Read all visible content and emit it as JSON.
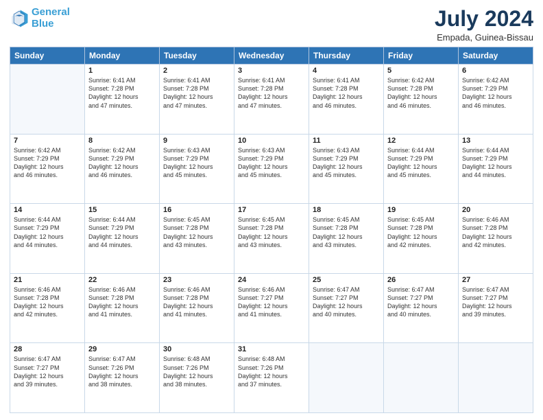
{
  "header": {
    "logo_line1": "General",
    "logo_line2": "Blue",
    "main_title": "July 2024",
    "subtitle": "Empada, Guinea-Bissau"
  },
  "days_of_week": [
    "Sunday",
    "Monday",
    "Tuesday",
    "Wednesday",
    "Thursday",
    "Friday",
    "Saturday"
  ],
  "weeks": [
    [
      {
        "day": "",
        "info": ""
      },
      {
        "day": "1",
        "info": "Sunrise: 6:41 AM\nSunset: 7:28 PM\nDaylight: 12 hours\nand 47 minutes."
      },
      {
        "day": "2",
        "info": "Sunrise: 6:41 AM\nSunset: 7:28 PM\nDaylight: 12 hours\nand 47 minutes."
      },
      {
        "day": "3",
        "info": "Sunrise: 6:41 AM\nSunset: 7:28 PM\nDaylight: 12 hours\nand 47 minutes."
      },
      {
        "day": "4",
        "info": "Sunrise: 6:41 AM\nSunset: 7:28 PM\nDaylight: 12 hours\nand 46 minutes."
      },
      {
        "day": "5",
        "info": "Sunrise: 6:42 AM\nSunset: 7:28 PM\nDaylight: 12 hours\nand 46 minutes."
      },
      {
        "day": "6",
        "info": "Sunrise: 6:42 AM\nSunset: 7:29 PM\nDaylight: 12 hours\nand 46 minutes."
      }
    ],
    [
      {
        "day": "7",
        "info": "Sunrise: 6:42 AM\nSunset: 7:29 PM\nDaylight: 12 hours\nand 46 minutes."
      },
      {
        "day": "8",
        "info": "Sunrise: 6:42 AM\nSunset: 7:29 PM\nDaylight: 12 hours\nand 46 minutes."
      },
      {
        "day": "9",
        "info": "Sunrise: 6:43 AM\nSunset: 7:29 PM\nDaylight: 12 hours\nand 45 minutes."
      },
      {
        "day": "10",
        "info": "Sunrise: 6:43 AM\nSunset: 7:29 PM\nDaylight: 12 hours\nand 45 minutes."
      },
      {
        "day": "11",
        "info": "Sunrise: 6:43 AM\nSunset: 7:29 PM\nDaylight: 12 hours\nand 45 minutes."
      },
      {
        "day": "12",
        "info": "Sunrise: 6:44 AM\nSunset: 7:29 PM\nDaylight: 12 hours\nand 45 minutes."
      },
      {
        "day": "13",
        "info": "Sunrise: 6:44 AM\nSunset: 7:29 PM\nDaylight: 12 hours\nand 44 minutes."
      }
    ],
    [
      {
        "day": "14",
        "info": "Sunrise: 6:44 AM\nSunset: 7:29 PM\nDaylight: 12 hours\nand 44 minutes."
      },
      {
        "day": "15",
        "info": "Sunrise: 6:44 AM\nSunset: 7:29 PM\nDaylight: 12 hours\nand 44 minutes."
      },
      {
        "day": "16",
        "info": "Sunrise: 6:45 AM\nSunset: 7:28 PM\nDaylight: 12 hours\nand 43 minutes."
      },
      {
        "day": "17",
        "info": "Sunrise: 6:45 AM\nSunset: 7:28 PM\nDaylight: 12 hours\nand 43 minutes."
      },
      {
        "day": "18",
        "info": "Sunrise: 6:45 AM\nSunset: 7:28 PM\nDaylight: 12 hours\nand 43 minutes."
      },
      {
        "day": "19",
        "info": "Sunrise: 6:45 AM\nSunset: 7:28 PM\nDaylight: 12 hours\nand 42 minutes."
      },
      {
        "day": "20",
        "info": "Sunrise: 6:46 AM\nSunset: 7:28 PM\nDaylight: 12 hours\nand 42 minutes."
      }
    ],
    [
      {
        "day": "21",
        "info": "Sunrise: 6:46 AM\nSunset: 7:28 PM\nDaylight: 12 hours\nand 42 minutes."
      },
      {
        "day": "22",
        "info": "Sunrise: 6:46 AM\nSunset: 7:28 PM\nDaylight: 12 hours\nand 41 minutes."
      },
      {
        "day": "23",
        "info": "Sunrise: 6:46 AM\nSunset: 7:28 PM\nDaylight: 12 hours\nand 41 minutes."
      },
      {
        "day": "24",
        "info": "Sunrise: 6:46 AM\nSunset: 7:27 PM\nDaylight: 12 hours\nand 41 minutes."
      },
      {
        "day": "25",
        "info": "Sunrise: 6:47 AM\nSunset: 7:27 PM\nDaylight: 12 hours\nand 40 minutes."
      },
      {
        "day": "26",
        "info": "Sunrise: 6:47 AM\nSunset: 7:27 PM\nDaylight: 12 hours\nand 40 minutes."
      },
      {
        "day": "27",
        "info": "Sunrise: 6:47 AM\nSunset: 7:27 PM\nDaylight: 12 hours\nand 39 minutes."
      }
    ],
    [
      {
        "day": "28",
        "info": "Sunrise: 6:47 AM\nSunset: 7:27 PM\nDaylight: 12 hours\nand 39 minutes."
      },
      {
        "day": "29",
        "info": "Sunrise: 6:47 AM\nSunset: 7:26 PM\nDaylight: 12 hours\nand 38 minutes."
      },
      {
        "day": "30",
        "info": "Sunrise: 6:48 AM\nSunset: 7:26 PM\nDaylight: 12 hours\nand 38 minutes."
      },
      {
        "day": "31",
        "info": "Sunrise: 6:48 AM\nSunset: 7:26 PM\nDaylight: 12 hours\nand 37 minutes."
      },
      {
        "day": "",
        "info": ""
      },
      {
        "day": "",
        "info": ""
      },
      {
        "day": "",
        "info": ""
      }
    ]
  ]
}
